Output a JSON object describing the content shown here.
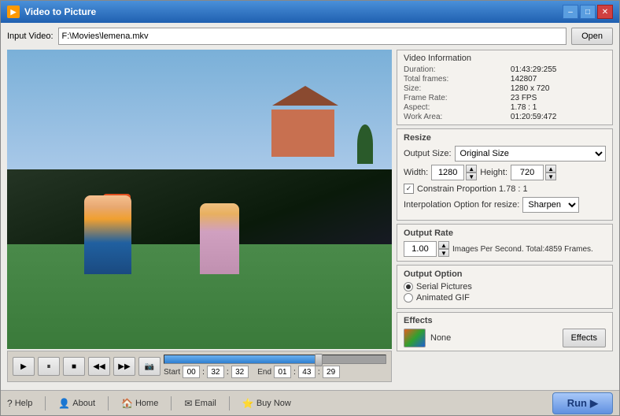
{
  "window": {
    "title": "Video to Picture",
    "icon": "▶"
  },
  "titlebar": {
    "minimize": "–",
    "maximize": "□",
    "close": "✕"
  },
  "input": {
    "label": "Input Video:",
    "value": "F:\\Movies\\lemena.mkv",
    "placeholder": "F:\\Movies\\lemena.mkv",
    "open_btn": "Open"
  },
  "video_info": {
    "title": "Video Information",
    "duration_label": "Duration:",
    "duration_val": "01:43:29:255",
    "total_frames_label": "Total frames:",
    "total_frames_val": "142807",
    "size_label": "Size:",
    "size_val": "1280 x 720",
    "frame_rate_label": "Frame Rate:",
    "frame_rate_val": "23 FPS",
    "aspect_label": "Aspect:",
    "aspect_val": "1.78 : 1",
    "work_area_label": "Work Area:",
    "work_area_val": "01:20:59:472"
  },
  "resize": {
    "title": "Resize",
    "output_size_label": "Output Size:",
    "output_size_val": "Original Size",
    "width_label": "Width:",
    "width_val": "1280",
    "height_label": "Height:",
    "height_val": "720",
    "constrain_label": "Constrain Proportion 1.78 : 1",
    "interp_label": "Interpolation Option for resize:",
    "interp_val": "Sharpen"
  },
  "output_rate": {
    "title": "Output Rate",
    "rate_val": "1.00",
    "rate_text": "Images Per Second. Total:4859 Frames."
  },
  "output_option": {
    "title": "Output Option",
    "serial_label": "Serial Pictures",
    "animated_label": "Animated GIF"
  },
  "effects": {
    "title": "Effects",
    "none_label": "None",
    "btn_label": "Effects"
  },
  "controls": {
    "play": "▶",
    "pause": "⏸",
    "stop": "■",
    "prev": "◀◀",
    "next": "▶▶",
    "camera": "📷"
  },
  "time": {
    "start_label": "Start",
    "start_h": "00",
    "start_m": "32",
    "start_s": "32",
    "end_label": "End",
    "end_h": "01",
    "end_m": "43",
    "end_s": "29"
  },
  "bottom": {
    "help": "Help",
    "about": "About",
    "home": "Home",
    "email": "Email",
    "buy": "Buy Now",
    "run": "Run"
  }
}
